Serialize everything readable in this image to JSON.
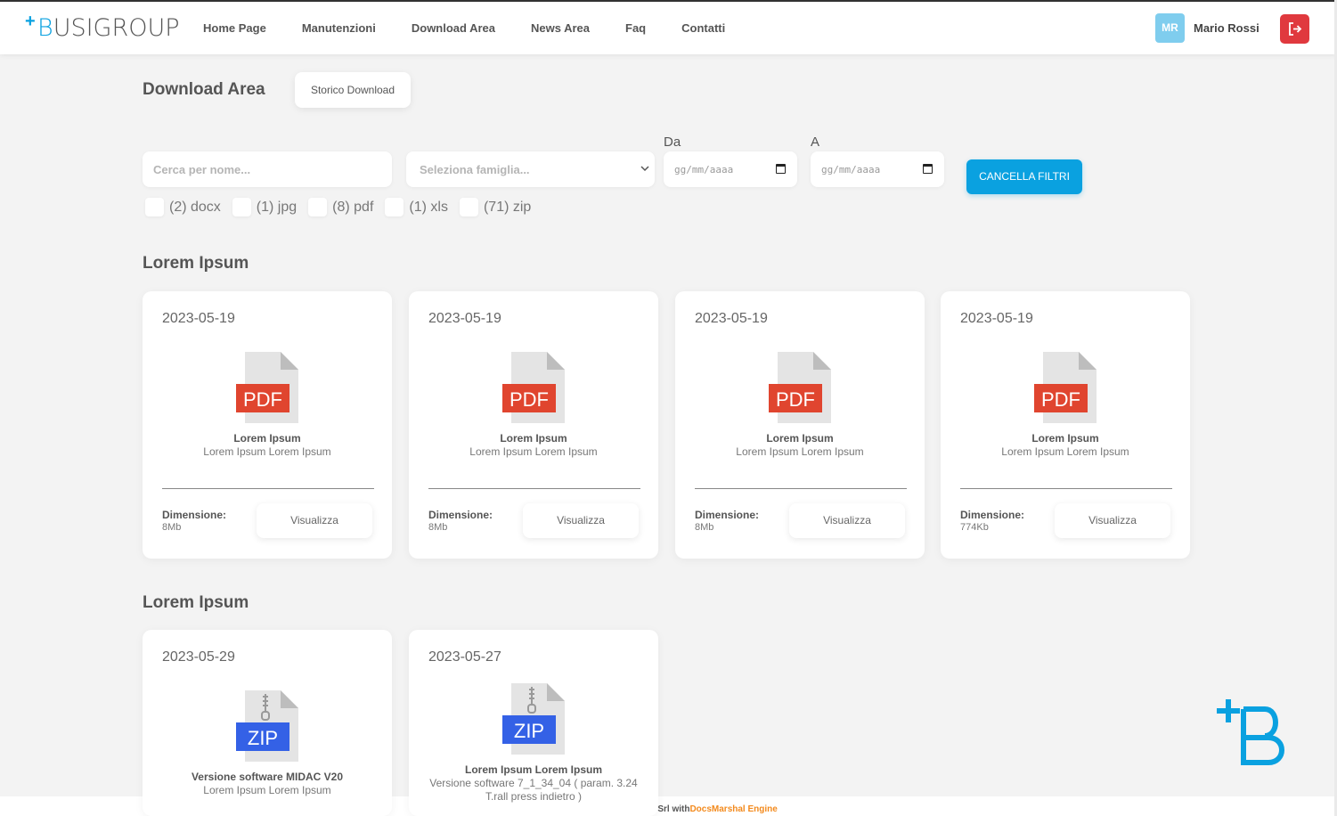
{
  "header": {
    "logo": {
      "plus": "+",
      "first": "B",
      "rest": "USIGROUP"
    },
    "nav": [
      "Home Page",
      "Manutenzioni",
      "Download Area",
      "News Area",
      "Faq",
      "Contatti"
    ],
    "user": {
      "initials": "MR",
      "name": "Mario Rossi"
    },
    "icons": {
      "logout": "logout-icon"
    }
  },
  "page": {
    "title": "Download Area",
    "storico_label": "Storico Download"
  },
  "filters": {
    "search_placeholder": "Cerca per nome...",
    "family_placeholder": "Seleziona famiglia...",
    "from_label": "Da",
    "to_label": "A",
    "date_placeholder": "gg/mm/aaaa",
    "clear_label": "CANCELLA FILTRI",
    "types": [
      "(2) docx",
      "(1) jpg",
      "(8) pdf",
      "(1) xls",
      "(71) zip"
    ]
  },
  "sections": [
    {
      "title": "Lorem Ipsum",
      "cards": [
        {
          "date": "2023-05-19",
          "type": "PDF",
          "name": "Lorem Ipsum",
          "desc": "Lorem Ipsum Lorem Ipsum",
          "dim_label": "Dimensione:",
          "dim": "8Mb",
          "view": "Visualizza"
        },
        {
          "date": "2023-05-19",
          "type": "PDF",
          "name": "Lorem Ipsum",
          "desc": "Lorem Ipsum Lorem Ipsum",
          "dim_label": "Dimensione:",
          "dim": "8Mb",
          "view": "Visualizza"
        },
        {
          "date": "2023-05-19",
          "type": "PDF",
          "name": "Lorem Ipsum",
          "desc": "Lorem Ipsum Lorem Ipsum",
          "dim_label": "Dimensione:",
          "dim": "8Mb",
          "view": "Visualizza"
        },
        {
          "date": "2023-05-19",
          "type": "PDF",
          "name": "Lorem Ipsum",
          "desc": "Lorem Ipsum Lorem Ipsum",
          "dim_label": "Dimensione:",
          "dim": "774Kb",
          "view": "Visualizza"
        }
      ]
    },
    {
      "title": "Lorem Ipsum",
      "cards": [
        {
          "date": "2023-05-29",
          "type": "ZIP",
          "name": "Versione software MIDAC V20",
          "desc": "Lorem Ipsum Lorem Ipsum"
        },
        {
          "date": "2023-05-27",
          "type": "ZIP",
          "name": "Lorem Ipsum Lorem Ipsum",
          "desc": "Versione software 7_1_34_04 ( param. 3.24 T.rall press indietro )"
        }
      ]
    }
  ],
  "footer": {
    "prefix": "a Srl with",
    "brand": "DocsMarshal Engine"
  },
  "colors": {
    "accent": "#0aa1e0",
    "pdf": "#e0452f",
    "zip": "#3461e6",
    "logout": "#e0393e",
    "footer_brand": "#f38a1d"
  }
}
